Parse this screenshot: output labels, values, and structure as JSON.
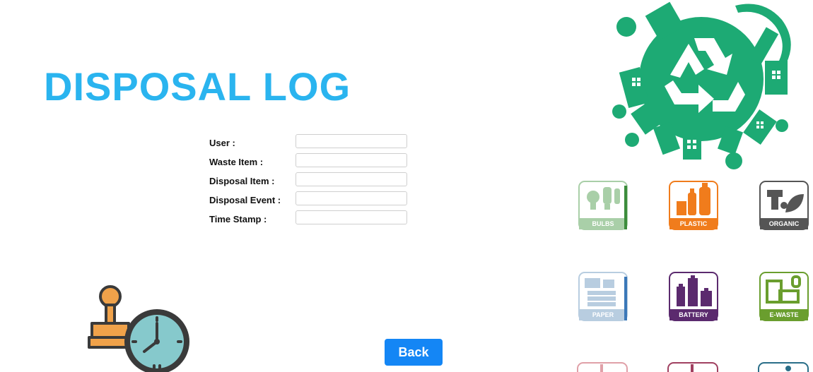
{
  "page": {
    "title": "DISPOSAL LOG",
    "back_label": "Back"
  },
  "form": {
    "fields": [
      {
        "label": "User :",
        "value": ""
      },
      {
        "label": "Waste Item :",
        "value": ""
      },
      {
        "label": "Disposal Item :",
        "value": ""
      },
      {
        "label": "Disposal Event :",
        "value": ""
      },
      {
        "label": "Time Stamp :",
        "value": ""
      }
    ]
  },
  "categories": [
    {
      "label": "BULBS",
      "color": "#a9cfa8",
      "icon": "bulb-icon"
    },
    {
      "label": "PLASTIC",
      "color": "#f07c1c",
      "icon": "plastic-bottle-icon"
    },
    {
      "label": "ORGANIC",
      "color": "#555555",
      "icon": "organic-waste-icon"
    },
    {
      "label": "PAPER",
      "color": "#b8cde0",
      "icon": "paper-icon"
    },
    {
      "label": "BATTERY",
      "color": "#5b2a6e",
      "icon": "battery-icon"
    },
    {
      "label": "E-WASTE",
      "color": "#6a9e2e",
      "icon": "computer-icon"
    }
  ],
  "colors": {
    "title": "#2ab4ef",
    "button": "#1486f5",
    "globe_green": "#1daa74"
  }
}
